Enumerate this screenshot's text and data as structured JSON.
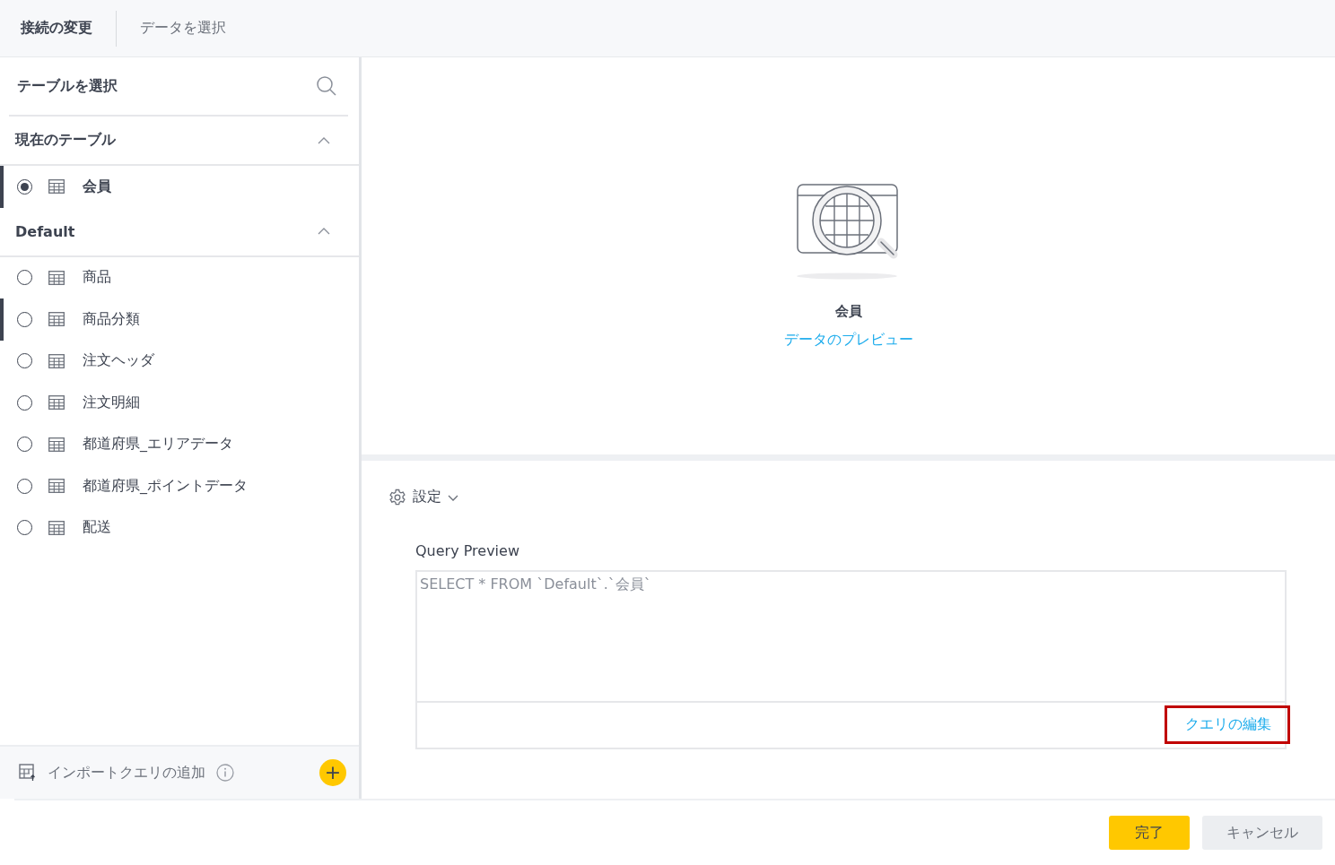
{
  "header": {
    "steps": [
      {
        "label": "接続の変更",
        "selected": true
      },
      {
        "label": "データを選択",
        "selected": false
      }
    ]
  },
  "sidebar": {
    "title": "テーブルを選択",
    "groups": [
      {
        "name": "現在のテーブル",
        "expanded": true,
        "items": [
          {
            "label": "会員",
            "selected": true,
            "hovered": true
          }
        ]
      },
      {
        "name": "Default",
        "expanded": true,
        "items": [
          {
            "label": "商品",
            "selected": false,
            "hovered": false
          },
          {
            "label": "商品分類",
            "selected": false,
            "hovered": true
          },
          {
            "label": "注文ヘッダ",
            "selected": false,
            "hovered": false
          },
          {
            "label": "注文明細",
            "selected": false,
            "hovered": false
          },
          {
            "label": "都道府県_エリアデータ",
            "selected": false,
            "hovered": false
          },
          {
            "label": "都道府県_ポイントデータ",
            "selected": false,
            "hovered": false
          },
          {
            "label": "配送",
            "selected": false,
            "hovered": false
          }
        ]
      }
    ],
    "footer": {
      "label": "インポートクエリの追加",
      "add_button": "+"
    }
  },
  "preview": {
    "table_name": "会員",
    "link": "データのプレビュー"
  },
  "settings": {
    "label": "設定",
    "expanded": false
  },
  "query": {
    "label": "Query Preview",
    "value": "SELECT * FROM `Default`.`会員`",
    "edit_link": "クエリの編集",
    "edit_highlighted": true
  },
  "buttons": [
    {
      "label": "完了",
      "kind": "primary"
    },
    {
      "label": "キャンセル",
      "kind": "secondary"
    }
  ]
}
